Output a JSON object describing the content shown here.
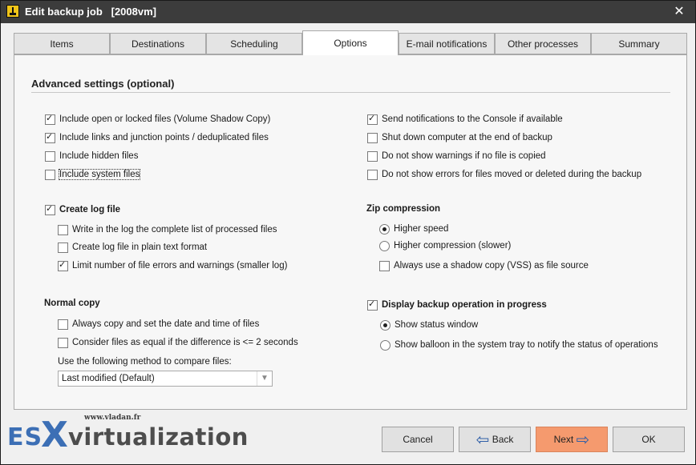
{
  "window": {
    "title": "Edit backup job   [2008vm]",
    "close_label": "✕"
  },
  "tabs": [
    {
      "label": "Items"
    },
    {
      "label": "Destinations"
    },
    {
      "label": "Scheduling"
    },
    {
      "label": "Options",
      "active": true
    },
    {
      "label": "E-mail notifications"
    },
    {
      "label": "Other processes"
    },
    {
      "label": "Summary"
    }
  ],
  "section": {
    "title": "Advanced settings (optional)"
  },
  "left_options": [
    {
      "label": "Include open or locked files (Volume Shadow Copy)",
      "checked": true
    },
    {
      "label": "Include links and junction points / deduplicated files",
      "checked": true
    },
    {
      "label": "Include hidden files",
      "checked": false
    },
    {
      "label": "Include system files",
      "checked": false
    }
  ],
  "right_options": [
    {
      "label": "Send notifications to the Console if available",
      "checked": true
    },
    {
      "label": "Shut down computer at the end of backup",
      "checked": false
    },
    {
      "label": "Do not show warnings if no file is copied",
      "checked": false
    },
    {
      "label": "Do not show errors for files moved or deleted during the backup",
      "checked": false
    }
  ],
  "log": {
    "label": "Create log file",
    "checked": true,
    "options": [
      {
        "label": "Write in the log the complete list of processed files",
        "checked": false
      },
      {
        "label": "Create log file in plain text format",
        "checked": false
      },
      {
        "label": "Limit number of file errors and warnings (smaller log)",
        "checked": true
      }
    ]
  },
  "zip": {
    "title": "Zip compression",
    "radios": [
      {
        "label": "Higher speed",
        "checked": true
      },
      {
        "label": "Higher compression (slower)",
        "checked": false
      }
    ],
    "vss": {
      "label": "Always use a shadow copy (VSS) as file source",
      "checked": false
    }
  },
  "normal_copy": {
    "title": "Normal copy",
    "options": [
      {
        "label": "Always copy and set the date and time of files",
        "checked": false
      },
      {
        "label": "Consider files as equal if the difference is <= 2 seconds",
        "checked": false
      }
    ],
    "compare_label": "Use the following method to compare files:",
    "compare_value": "Last modified (Default)"
  },
  "progress": {
    "label": "Display backup operation in progress",
    "checked": true,
    "radios": [
      {
        "label": "Show status window",
        "checked": true
      },
      {
        "label": "Show balloon in the system tray to notify the status of operations",
        "checked": false
      }
    ]
  },
  "buttons": {
    "cancel": "Cancel",
    "back": "Back",
    "next": "Next",
    "ok": "OK"
  },
  "watermark": {
    "url": "www.vladan.fr",
    "es": "ES",
    "x": "X",
    "virt": "virtualization"
  },
  "colors": {
    "titlebar": "#3c3c3c",
    "next_button": "#f59a6e",
    "arrow": "#2f5fa8",
    "logo_blue": "#3c6fb5"
  }
}
